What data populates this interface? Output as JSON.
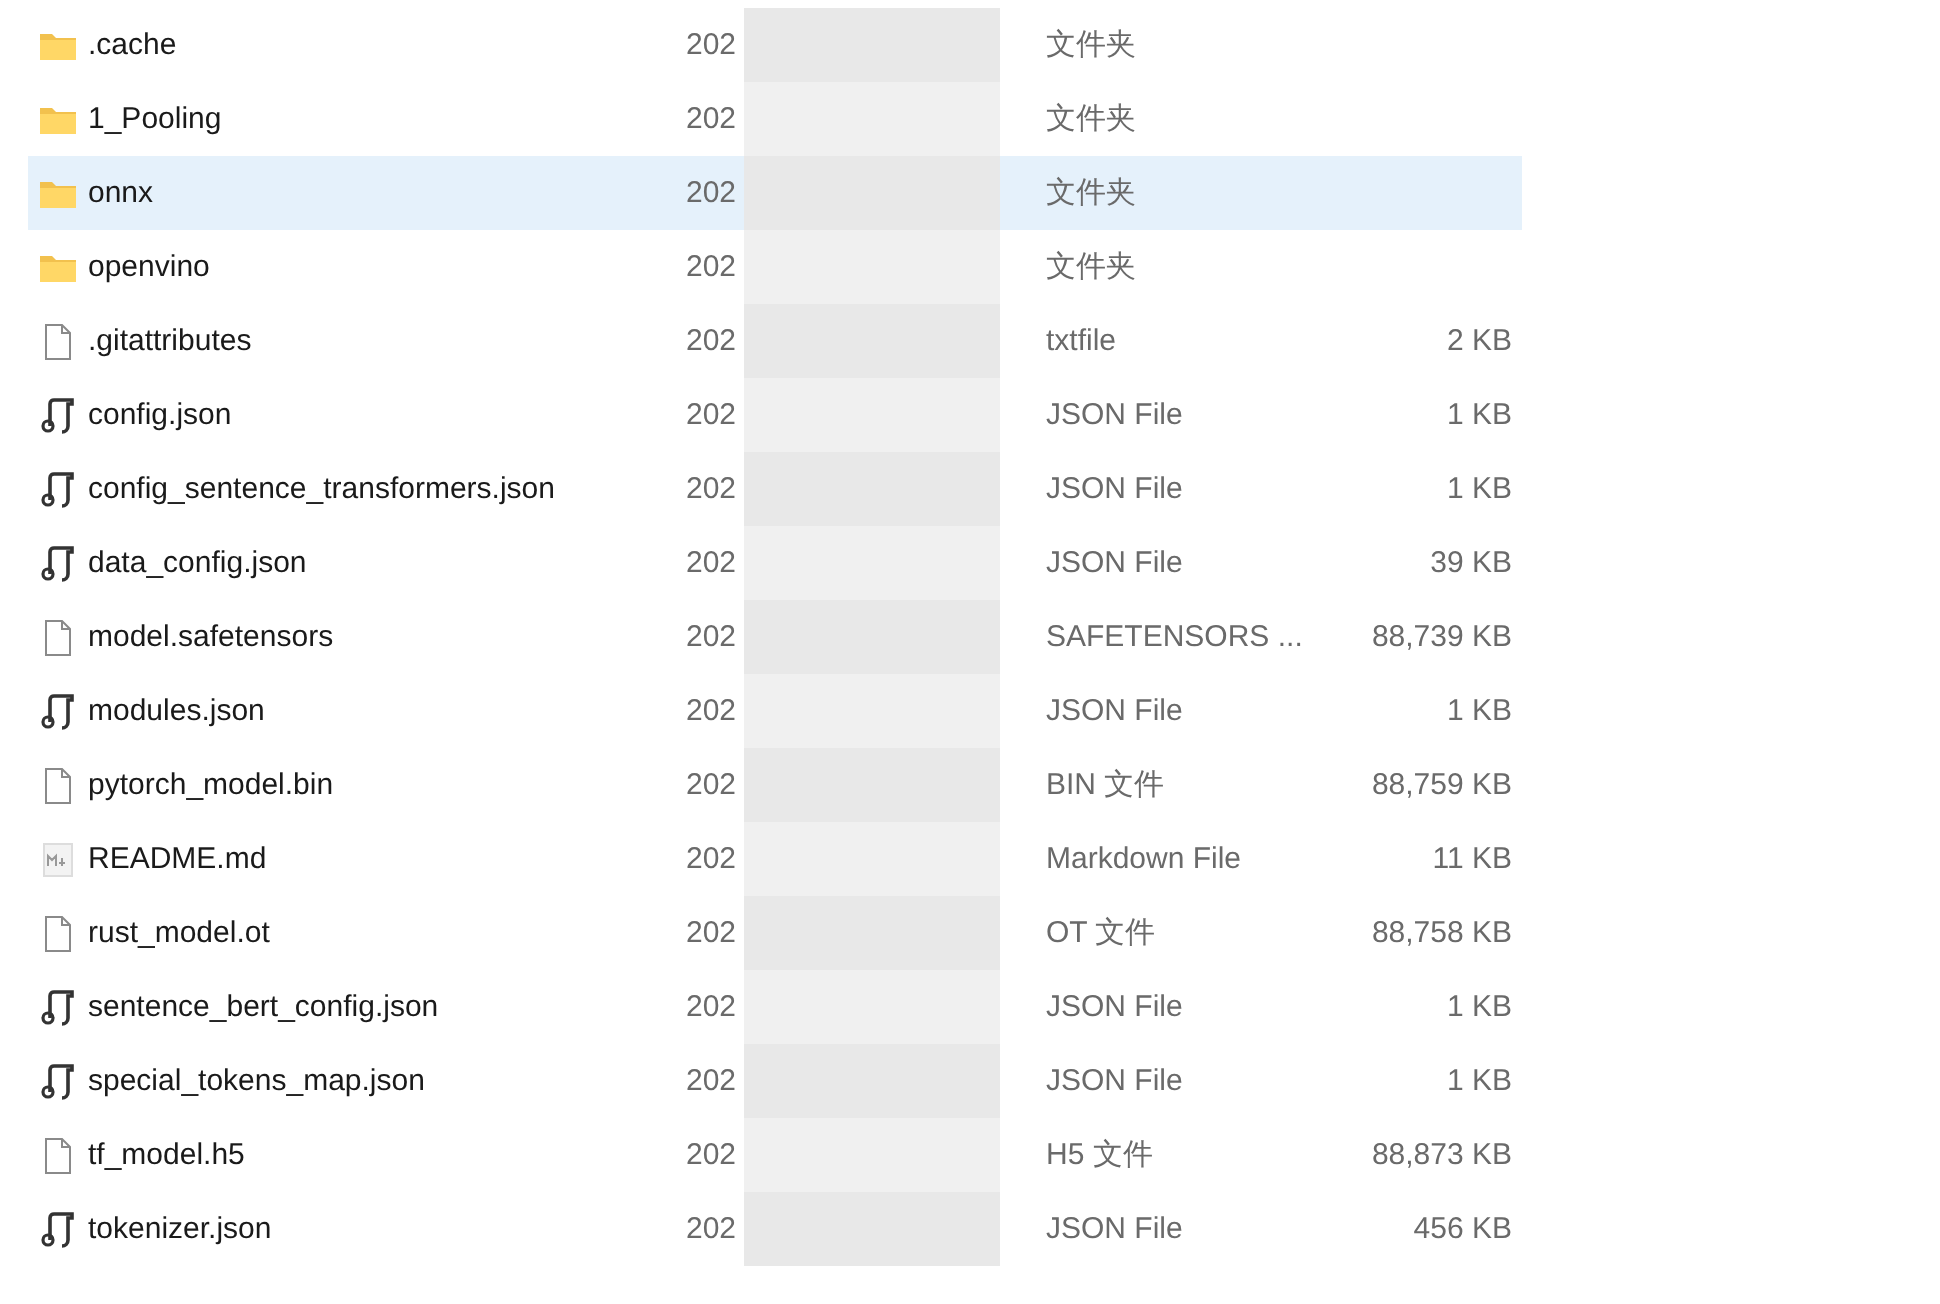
{
  "files": [
    {
      "kind": "folder",
      "name": ".cache",
      "date": "202",
      "type": "文件夹",
      "selected": false
    },
    {
      "kind": "folder",
      "name": "1_Pooling",
      "date": "202",
      "type": "文件夹",
      "selected": false
    },
    {
      "kind": "folder",
      "name": "onnx",
      "date": "202",
      "type": "文件夹",
      "selected": true
    },
    {
      "kind": "folder",
      "name": "openvino",
      "date": "202",
      "type": "文件夹",
      "selected": false
    },
    {
      "kind": "file",
      "name": ".gitattributes",
      "date": "202",
      "type": "txtfile",
      "size": "2 KB",
      "selected": false
    },
    {
      "kind": "json",
      "name": "config.json",
      "date": "202",
      "type": "JSON File",
      "size": "1 KB",
      "selected": false
    },
    {
      "kind": "json",
      "name": "config_sentence_transformers.json",
      "date": "202",
      "type": "JSON File",
      "size": "1 KB",
      "selected": false
    },
    {
      "kind": "json",
      "name": "data_config.json",
      "date": "202",
      "type": "JSON File",
      "size": "39 KB",
      "selected": false
    },
    {
      "kind": "file",
      "name": "model.safetensors",
      "date": "202",
      "type": "SAFETENSORS ...",
      "size": "88,739 KB",
      "selected": false
    },
    {
      "kind": "json",
      "name": "modules.json",
      "date": "202",
      "type": "JSON File",
      "size": "1 KB",
      "selected": false
    },
    {
      "kind": "file",
      "name": "pytorch_model.bin",
      "date": "202",
      "type": "BIN 文件",
      "size": "88,759 KB",
      "selected": false
    },
    {
      "kind": "markdown",
      "name": "README.md",
      "date": "202",
      "type": "Markdown File",
      "size": "11 KB",
      "selected": false
    },
    {
      "kind": "file",
      "name": "rust_model.ot",
      "date": "202",
      "type": "OT 文件",
      "size": "88,758 KB",
      "selected": false
    },
    {
      "kind": "json",
      "name": "sentence_bert_config.json",
      "date": "202",
      "type": "JSON File",
      "size": "1 KB",
      "selected": false
    },
    {
      "kind": "json",
      "name": "special_tokens_map.json",
      "date": "202",
      "type": "JSON File",
      "size": "1 KB",
      "selected": false
    },
    {
      "kind": "file",
      "name": "tf_model.h5",
      "date": "202",
      "type": "H5 文件",
      "size": "88,873 KB",
      "selected": false
    },
    {
      "kind": "json",
      "name": "tokenizer.json",
      "date": "202",
      "type": "JSON File",
      "size": "456 KB",
      "selected": false
    }
  ]
}
